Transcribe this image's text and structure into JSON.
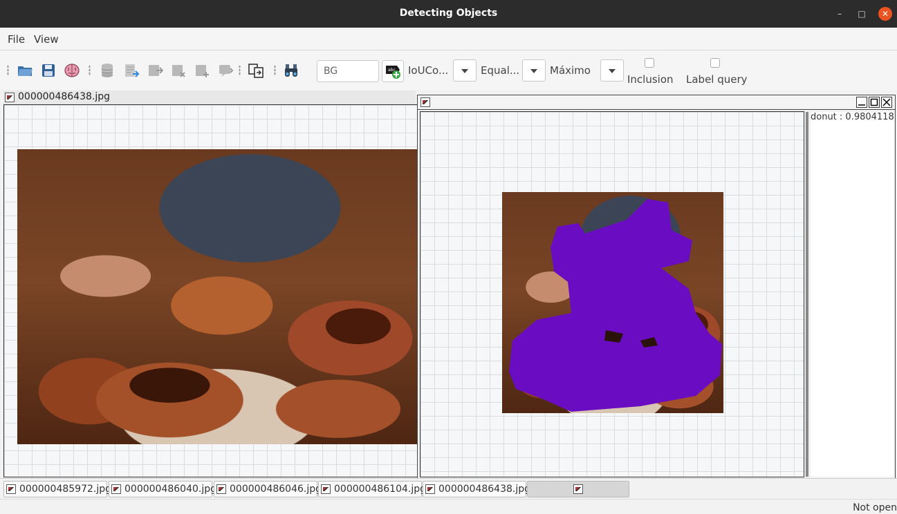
{
  "window": {
    "title": "Detecting Objects"
  },
  "menu": {
    "file": "File",
    "view": "View"
  },
  "toolbar": {
    "label_input_value": "BG",
    "combo1_label": "IoUCo...",
    "combo2_label": "Equal...",
    "combo3_label": "Máximo",
    "inclusion_label": "Inclusion",
    "label_query_label": "Label query",
    "icons": [
      "folder-open-icon",
      "save-icon",
      "brain-icon",
      "database-icon",
      "import-icon",
      "export-icon",
      "delete-icon",
      "add-icon",
      "comment-icon",
      "compare-icon",
      "binoculars-icon",
      "add-label-icon"
    ]
  },
  "left_panel": {
    "title": "000000486438.jpg"
  },
  "right_panel": {
    "labels": [
      "donut : 0.9804118"
    ],
    "mask_color": "#6a0dc2"
  },
  "tabs": [
    {
      "name": "000000485972.jpg"
    },
    {
      "name": "000000486040.jpg"
    },
    {
      "name": "000000486046.jpg"
    },
    {
      "name": "000000486104.jpg"
    },
    {
      "name": "000000486438.jpg"
    },
    {
      "name": ""
    }
  ],
  "status": {
    "text": "Not open"
  }
}
